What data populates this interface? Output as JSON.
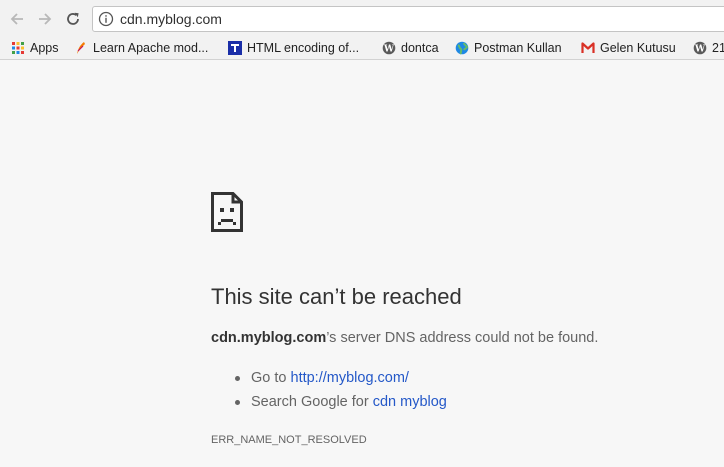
{
  "browser": {
    "url": "cdn.myblog.com",
    "bookmarks": [
      {
        "label": "Apps",
        "icon": "apps-grid-icon"
      },
      {
        "label": "Learn Apache mod...",
        "icon": "apache-feather-icon"
      },
      {
        "label": "HTML encoding of...",
        "icon": "t-logo-icon"
      },
      {
        "label": "dontca",
        "icon": "wordpress-icon"
      },
      {
        "label": "Postman Kullan",
        "icon": "globe-icon"
      },
      {
        "label": "Gelen Kutusu",
        "icon": "gmail-icon"
      },
      {
        "label": "21",
        "icon": "wordpress-icon"
      }
    ]
  },
  "error": {
    "title": "This site can’t be reached",
    "host": "cdn.myblog.com",
    "message_suffix": "’s server DNS address could not be found.",
    "suggestions": {
      "goto_prefix": "Go to ",
      "goto_link": "http://myblog.com/",
      "search_prefix": "Search Google for ",
      "search_link": "cdn myblog"
    },
    "code": "ERR_NAME_NOT_RESOLVED"
  },
  "colors": {
    "link": "#2458c8",
    "page_background": "#f7f7f7",
    "text": "#646464"
  }
}
